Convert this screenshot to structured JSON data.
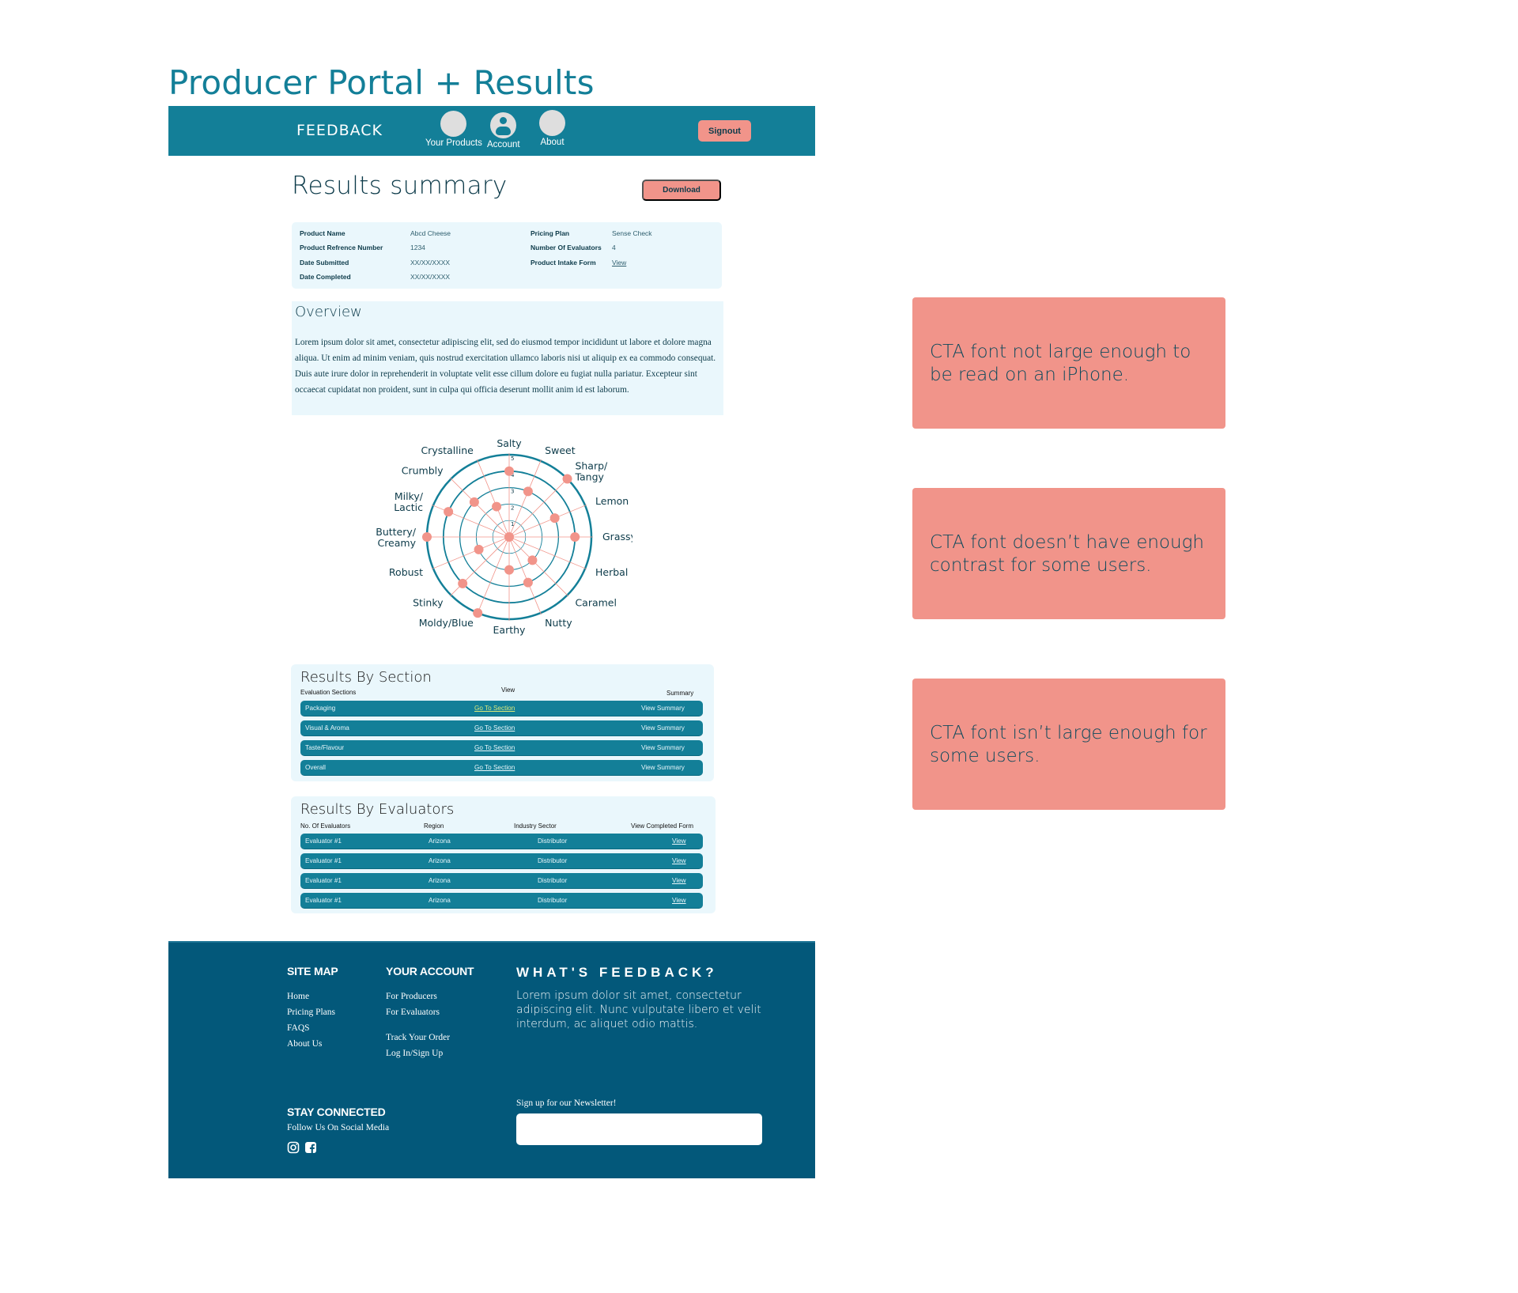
{
  "page_title": "Producer Portal + Results",
  "navbar": {
    "brand": "FEEDBACK",
    "items": [
      {
        "label": "Your Products",
        "icon": "placeholder-circle-icon"
      },
      {
        "label": "Account",
        "icon": "account-icon"
      },
      {
        "label": "About",
        "icon": "placeholder-circle-icon"
      }
    ],
    "signout_label": "Signout"
  },
  "results": {
    "title": "Results summary",
    "download_label": "Download"
  },
  "info": {
    "left": [
      {
        "label": "Product Name",
        "value": "Abcd Cheese"
      },
      {
        "label": "Product Refrence Number",
        "value": "1234"
      },
      {
        "label": "Date Submitted",
        "value": "XX/XX/XXXX"
      },
      {
        "label": "Date Completed",
        "value": "XX/XX/XXXX"
      }
    ],
    "right": [
      {
        "label": "Pricing Plan",
        "value": "Sense Check"
      },
      {
        "label": "Number Of Evaluators",
        "value": "4"
      },
      {
        "label": "Product Intake Form",
        "value": "View"
      }
    ]
  },
  "overview": {
    "title": "Overview",
    "text": "Lorem ipsum dolor sit amet, consectetur adipiscing elit, sed do eiusmod tempor incididunt ut labore et dolore magna aliqua. Ut enim ad minim veniam, quis nostrud exercitation ullamco laboris nisi ut aliquip ex ea commodo consequat. Duis aute irure dolor in reprehenderit in voluptate velit esse cillum dolore eu fugiat nulla pariatur. Excepteur sint occaecat cupidatat non proident, sunt in culpa qui officia deserunt mollit anim id est laborum."
  },
  "chart_data": {
    "type": "radar",
    "title": "",
    "axes": [
      "Salty",
      "Sweet",
      "Sharp/ Tangy",
      "Lemon",
      "Grassy",
      "Herbal",
      "Caramel",
      "Nutty",
      "Earthy",
      "Moldy/Blue",
      "Stinky",
      "Robust",
      "Buttery/ Creamy",
      "Milky/ Lactic",
      "Crumbly",
      "Crystalline"
    ],
    "values": [
      4,
      3,
      5,
      3,
      4,
      0,
      2,
      3,
      2,
      5,
      4,
      2,
      5,
      4,
      3,
      2
    ],
    "range": [
      0,
      5
    ],
    "ticks": [
      "1",
      "2",
      "3",
      "4",
      "5"
    ],
    "colors": {
      "ring": "#137f98",
      "spoke": "#f1948a",
      "point": "#f1948a"
    }
  },
  "by_section": {
    "title": "Results By Section",
    "headers": [
      "Evaluation Sections",
      "View",
      "Summary"
    ],
    "rows": [
      {
        "section": "Packaging",
        "view": "Go To Section",
        "summary": "View Summary"
      },
      {
        "section": "Visual & Aroma",
        "view": "Go To Section",
        "summary": "View Summary"
      },
      {
        "section": "Taste/Flavour",
        "view": "Go To Section",
        "summary": "View Summary"
      },
      {
        "section": "Overall",
        "view": "Go To Section",
        "summary": "View Summary"
      }
    ]
  },
  "by_evaluators": {
    "title": "Results By Evaluators",
    "headers": [
      "No. Of Evaluators",
      "Region",
      "Industry Sector",
      "View Completed Form"
    ],
    "rows": [
      {
        "evaluator": "Evaluator #1",
        "region": "Arizona",
        "sector": "Distributor",
        "form": "View"
      },
      {
        "evaluator": "Evaluator #1",
        "region": "Arizona",
        "sector": "Distributor",
        "form": "View"
      },
      {
        "evaluator": "Evaluator #1",
        "region": "Arizona",
        "sector": "Distributor",
        "form": "View"
      },
      {
        "evaluator": "Evaluator #1",
        "region": "Arizona",
        "sector": "Distributor",
        "form": "View"
      }
    ]
  },
  "footer": {
    "site_map": {
      "title": "SITE MAP",
      "links": [
        "Home",
        "Pricing Plans",
        "FAQS",
        "About Us"
      ]
    },
    "your_account": {
      "title": "YOUR ACCOUNT",
      "links": [
        "For Producers",
        "For Evaluators",
        "Track Your Order",
        "Log In/Sign Up"
      ]
    },
    "whats_feedback": {
      "title": "WHAT'S FEEDBACK?",
      "text": "Lorem ipsum dolor sit amet, consectetur adipiscing elit. Nunc vulputate libero et velit interdum, ac aliquet odio mattis."
    },
    "stay_connected": {
      "title": "STAY CONNECTED",
      "subtitle": "Follow Us On Social Media",
      "icons": [
        "instagram-icon",
        "facebook-icon"
      ]
    },
    "newsletter": {
      "label": "Sign up for our Newsletter!",
      "value": "",
      "placeholder": ""
    }
  },
  "annotations": [
    "CTA font not large enough to be read on an iPhone.",
    "CTA font doesn’t have enough contrast for some users.",
    "CTA font isn’t large enough for some users."
  ],
  "colors": {
    "brand_teal": "#137f98",
    "footer_blue": "#03587a",
    "cta_salmon": "#f1948a",
    "panel_bg": "#eaf7fc",
    "text_dark": "#0d3b4a"
  }
}
